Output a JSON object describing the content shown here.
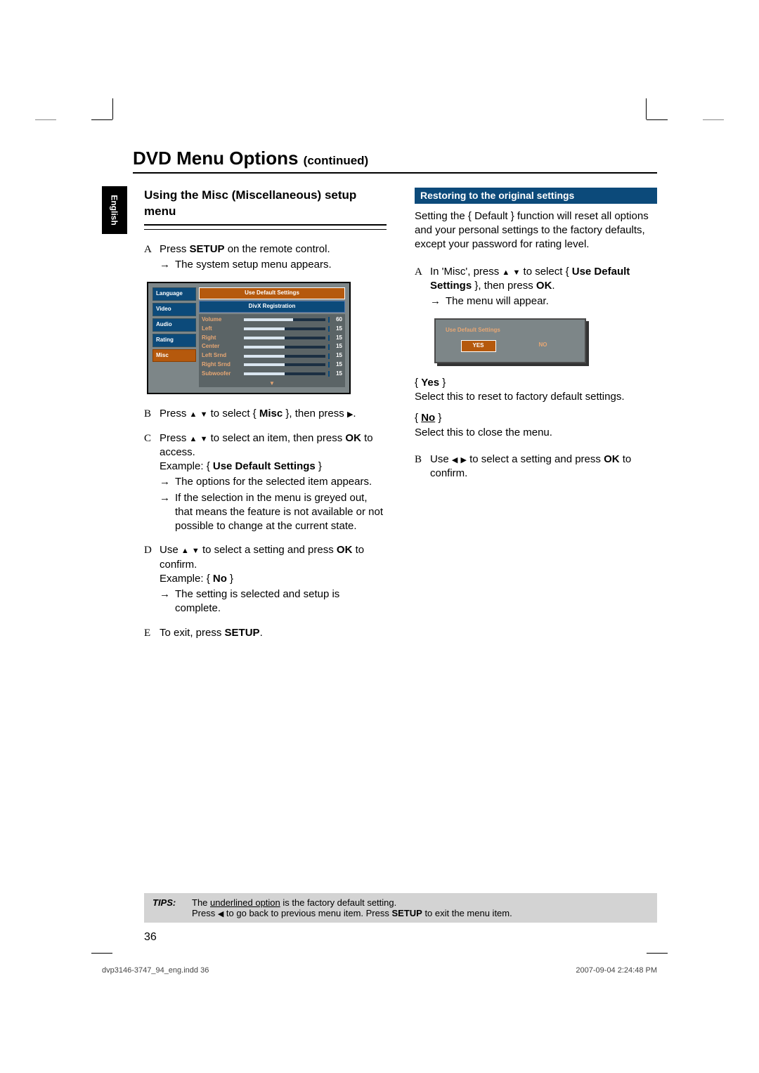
{
  "title_main": "DVD Menu Options",
  "title_suffix": "(continued)",
  "lang_tab": "English",
  "left": {
    "subhead": "Using the Misc (Miscellaneous) setup menu",
    "stepA": {
      "marker": "A",
      "pre": "Press ",
      "b1": "SETUP",
      "post": " on the remote control.",
      "sub1": "The system setup menu appears."
    },
    "stepB": {
      "marker": "B",
      "pre": "Press ",
      "mid": " to select { ",
      "b1": "Misc",
      "post": " }, then press "
    },
    "stepC": {
      "marker": "C",
      "pre": "Press ",
      "mid": " to select an item, then press ",
      "b1": "OK",
      "post": " to access.",
      "ex_pre": "Example: { ",
      "ex_b": "Use Default Settings",
      "ex_post": " }",
      "sub1": "The options for the selected item appears.",
      "sub2": "If the selection in the menu is greyed out, that means the feature is not available or not possible to change at the current state."
    },
    "stepD": {
      "marker": "D",
      "pre": "Use ",
      "mid": " to select a setting and press ",
      "b1": "OK",
      "post": " to confirm.",
      "ex_pre": "Example: { ",
      "ex_b": "No",
      "ex_post": " }",
      "sub1": "The setting is selected and setup is complete."
    },
    "stepE": {
      "marker": "E",
      "pre": "To exit, press ",
      "b1": "SETUP",
      "post": "."
    }
  },
  "right": {
    "bar": "Restoring to the original settings",
    "intro": "Setting the { Default } function will reset all options and your personal settings to the factory defaults, except your password for rating level.",
    "stepA": {
      "marker": "A",
      "pre": "In 'Misc', press ",
      "mid": " to select { ",
      "b1": "Use Default Settings",
      "post": " }, then press ",
      "b2": "OK",
      "post2": ".",
      "sub1": "The menu will appear."
    },
    "yes_lbl": "Yes",
    "yes_txt": "Select this to reset to factory default settings.",
    "no_lbl": "No",
    "no_txt": "Select this to close the menu.",
    "stepB": {
      "marker": "B",
      "pre": "Use ",
      "mid": " to select a setting and press ",
      "b1": "OK",
      "post": " to confirm."
    }
  },
  "osd": {
    "tabs": [
      "Language",
      "Video",
      "Audio",
      "Rating",
      "Misc"
    ],
    "active_tab_index": 4,
    "hdr1": "Use Default Settings",
    "hdr2": "DivX Registration",
    "rows": [
      {
        "lbl": "Volume",
        "val": "60",
        "pct": 60
      },
      {
        "lbl": "Left",
        "val": "15",
        "pct": 50
      },
      {
        "lbl": "Right",
        "val": "15",
        "pct": 50
      },
      {
        "lbl": "Center",
        "val": "15",
        "pct": 50
      },
      {
        "lbl": "Left Srnd",
        "val": "15",
        "pct": 50
      },
      {
        "lbl": "Right Srnd",
        "val": "15",
        "pct": 50
      },
      {
        "lbl": "Subwoofer",
        "val": "15",
        "pct": 50
      }
    ]
  },
  "osd2": {
    "title": "Use Default Settings",
    "yes": "YES",
    "no": "NO"
  },
  "tips": {
    "label": "TIPS:",
    "line1a": "The ",
    "line1u": "underlined option",
    "line1b": " is the factory default setting.",
    "line2a": "Press ",
    "line2b": " to go back to previous menu item. Press ",
    "line2bold": "SETUP",
    "line2c": " to exit the menu item."
  },
  "page_number": "36",
  "footer_left": "dvp3146-3747_94_eng.indd   36",
  "footer_right": "2007-09-04   2:24:48 PM"
}
